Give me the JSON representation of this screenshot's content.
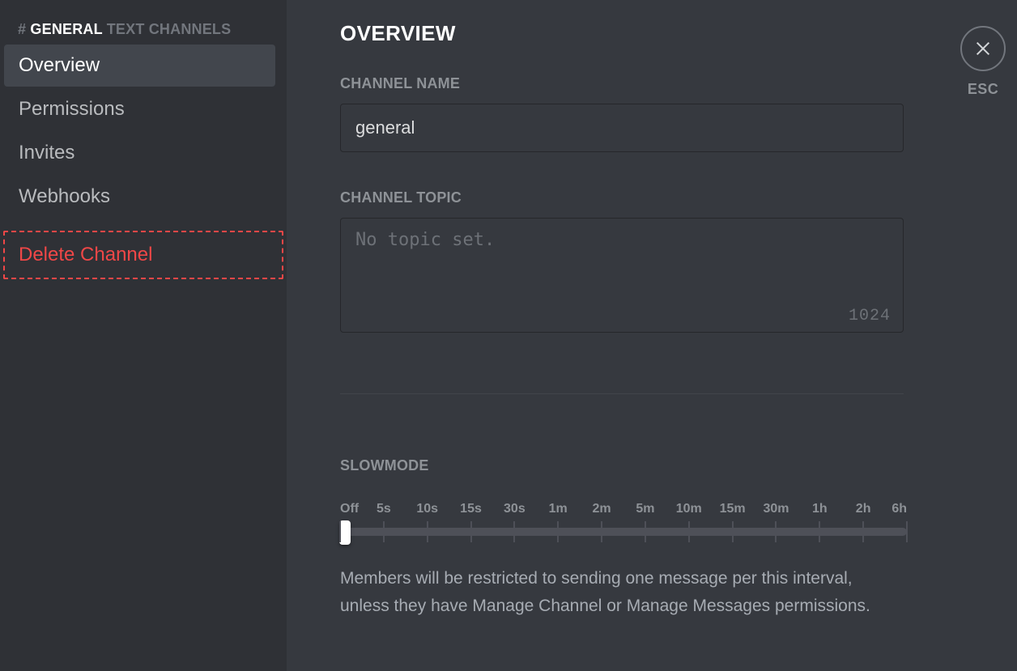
{
  "sidebar": {
    "hash": "#",
    "channel": "GENERAL",
    "group": "TEXT CHANNELS",
    "items": [
      {
        "label": "Overview",
        "active": true
      },
      {
        "label": "Permissions",
        "active": false
      },
      {
        "label": "Invites",
        "active": false
      },
      {
        "label": "Webhooks",
        "active": false
      }
    ],
    "delete_label": "Delete Channel"
  },
  "main": {
    "title": "OVERVIEW",
    "channel_name_label": "CHANNEL NAME",
    "channel_name_value": "general",
    "channel_topic_label": "CHANNEL TOPIC",
    "channel_topic_placeholder": "No topic set.",
    "channel_topic_value": "",
    "topic_max": "1024",
    "slowmode_label": "SLOWMODE",
    "slowmode_ticks": [
      "Off",
      "5s",
      "10s",
      "15s",
      "30s",
      "1m",
      "2m",
      "5m",
      "10m",
      "15m",
      "30m",
      "1h",
      "2h",
      "6h"
    ],
    "slowmode_help": "Members will be restricted to sending one message per this interval, unless they have Manage Channel or Manage Messages permissions."
  },
  "close": {
    "label": "ESC"
  }
}
